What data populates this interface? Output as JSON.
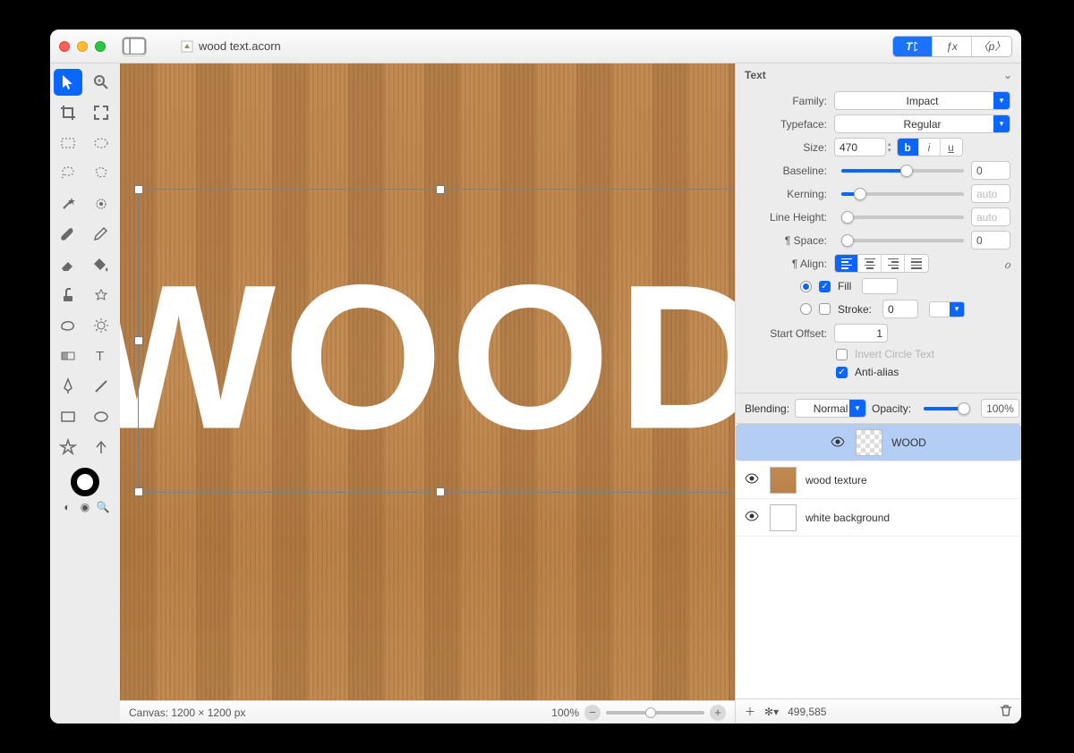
{
  "window": {
    "filename": "wood text.acorn"
  },
  "toolbar_tabs": {
    "text": "T",
    "fx": "ƒx",
    "palette": "〈p〉"
  },
  "text_panel": {
    "header": "Text",
    "labels": {
      "family": "Family:",
      "typeface": "Typeface:",
      "size": "Size:",
      "baseline": "Baseline:",
      "kerning": "Kerning:",
      "lineheight": "Line Height:",
      "pspace": "¶ Space:",
      "align": "¶ Align:",
      "fill": "Fill",
      "stroke": "Stroke:",
      "start_offset": "Start Offset:",
      "invert": "Invert Circle Text",
      "antialias": "Anti-alias"
    },
    "values": {
      "family": "Impact",
      "typeface": "Regular",
      "size": "470",
      "baseline": "0",
      "kerning_ph": "auto",
      "lineheight_ph": "auto",
      "pspace": "0",
      "stroke": "0",
      "start_offset": "1"
    }
  },
  "blending": {
    "label": "Blending:",
    "mode": "Normal",
    "opacity_label": "Opacity:",
    "opacity": "100%"
  },
  "layers": [
    {
      "name": "WOOD",
      "thumb": "checker",
      "selected": true
    },
    {
      "name": "wood texture",
      "thumb": "wood",
      "selected": false
    },
    {
      "name": "white background",
      "thumb": "white",
      "selected": false
    }
  ],
  "statusbar": {
    "canvas": "Canvas: 1200 × 1200 px",
    "zoom": "100%"
  },
  "bottombar": {
    "count": "499,585"
  },
  "canvas_text": "WOOD"
}
